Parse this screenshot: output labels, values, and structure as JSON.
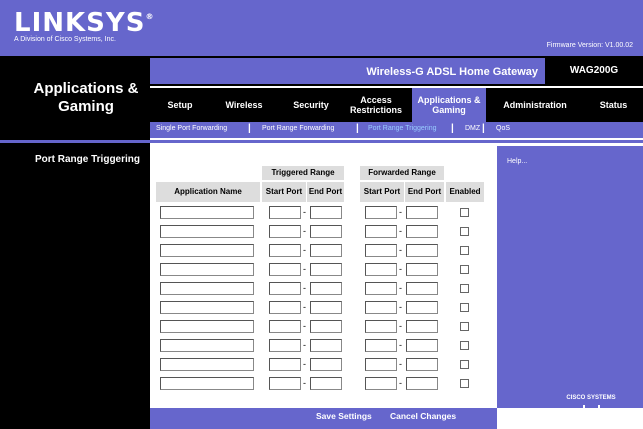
{
  "brand": {
    "logo": "LINKSYS",
    "reg": "®",
    "sub": "A Division of Cisco Systems, Inc.",
    "firmware": "Firmware Version: V1.00.02"
  },
  "product": {
    "name": "Wireless-G ADSL Home Gateway",
    "model": "WAG200G"
  },
  "section": {
    "title": "Applications & Gaming",
    "side_label": "Port Range Triggering"
  },
  "tabs": [
    {
      "label": "Setup"
    },
    {
      "label": "Wireless"
    },
    {
      "label": "Security"
    },
    {
      "label": "Access Restrictions"
    },
    {
      "label": "Applications & Gaming"
    },
    {
      "label": "Administration"
    },
    {
      "label": "Status"
    }
  ],
  "subtabs": [
    {
      "label": "Single Port Forwarding"
    },
    {
      "label": "Port Range Forwarding"
    },
    {
      "label": "Port Range Triggering"
    },
    {
      "label": "DMZ"
    },
    {
      "label": "QoS"
    }
  ],
  "separator": "|",
  "table": {
    "triggered_range": "Triggered Range",
    "forwarded_range": "Forwarded Range",
    "application_name": "Application Name",
    "start_port": "Start Port",
    "end_port": "End Port",
    "enabled": "Enabled",
    "dash": "-",
    "rows": 10
  },
  "help": "Help...",
  "buttons": {
    "save": "Save Settings",
    "cancel": "Cancel Changes"
  },
  "cisco_logo": "CISCO SYSTEMS",
  "colors": {
    "purple": "#6666cc",
    "black": "#000000",
    "header_gray": "#dddddd",
    "active_subtab": "#99ccff"
  }
}
